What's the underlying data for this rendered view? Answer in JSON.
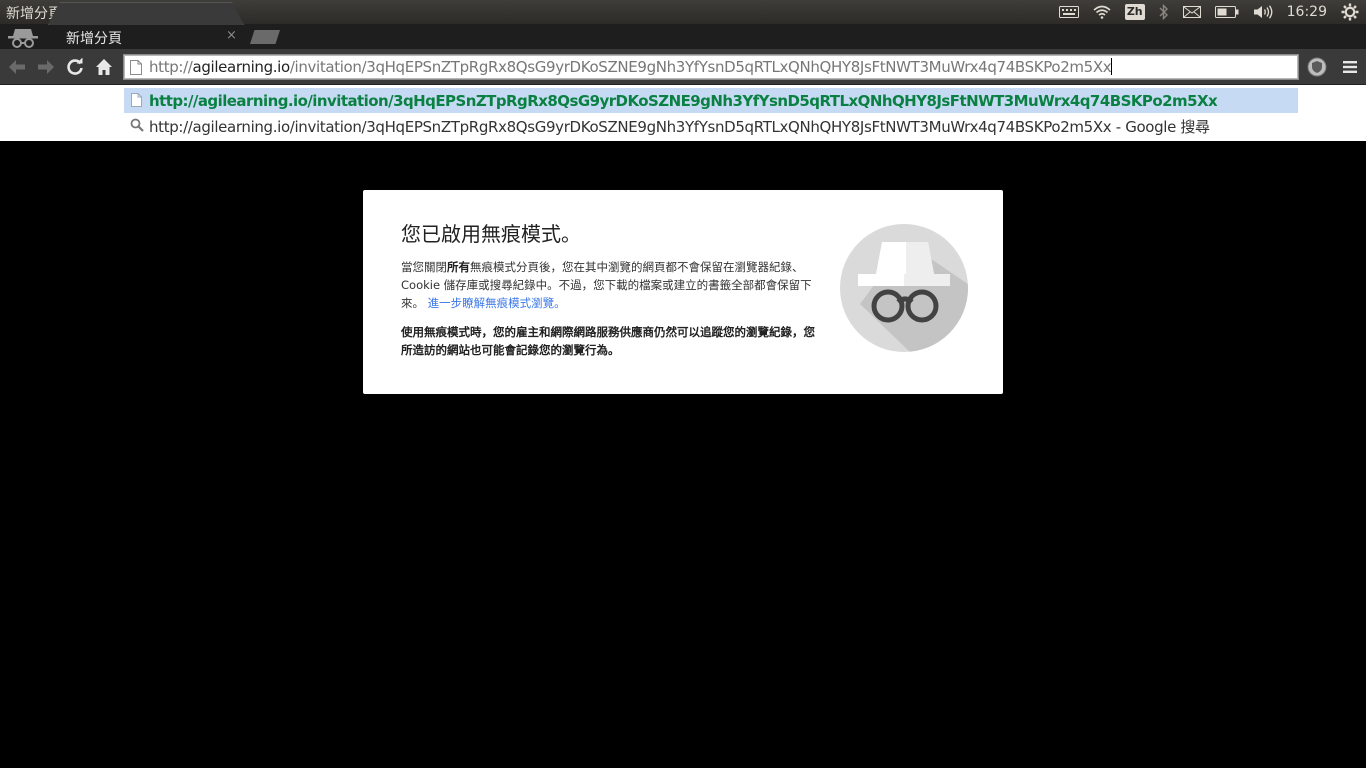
{
  "window": {
    "title": "新增分頁 - Google Chrome"
  },
  "tray": {
    "input_method": "Zh",
    "clock": "16:29"
  },
  "tab": {
    "title": "新增分頁",
    "close": "×"
  },
  "omnibox": {
    "scheme": "http://",
    "host": "agilearning.io",
    "path": "/invitation/3qHqEPSnZTpRgRx8QsG9yrDKoSZNE9gNh3YfYsnD5qRTLxQNhQHY8JsFtNWT3MuWrx4q74BSKPo2m5Xx"
  },
  "suggestions": [
    {
      "text": "http://agilearning.io/invitation/3qHqEPSnZTpRgRx8QsG9yrDKoSZNE9gNh3YfYsnD5qRTLxQNhQHY8JsFtNWT3MuWrx4q74BSKPo2m5Xx",
      "type": "url"
    },
    {
      "text": "http://agilearning.io/invitation/3qHqEPSnZTpRgRx8QsG9yrDKoSZNE9gNh3YfYsnD5qRTLxQNhQHY8JsFtNWT3MuWrx4q74BSKPo2m5Xx - Google 搜尋",
      "type": "search"
    }
  ],
  "incognito": {
    "title": "您已啟用無痕模式。",
    "para_prefix": "當您關閉",
    "para_bold": "所有",
    "para_rest": "無痕模式分頁後，您在其中瀏覽的網頁都不會保留在瀏覽器紀錄、Cookie 儲存庫或搜尋紀錄中。不過，您下載的檔案或建立的書籤全部都會保留下來。",
    "learn_more": "進一步瞭解無痕模式瀏覽。",
    "warning": "使用無痕模式時，您的雇主和網際網路服務供應商仍然可以追蹤您的瀏覽紀錄，您所造訪的網站也可能會記錄您的瀏覽行為。"
  },
  "colors": {
    "suggestion_highlight": "#c6dbf3",
    "url_green": "#0b8043",
    "link_blue": "#3b78e7"
  }
}
